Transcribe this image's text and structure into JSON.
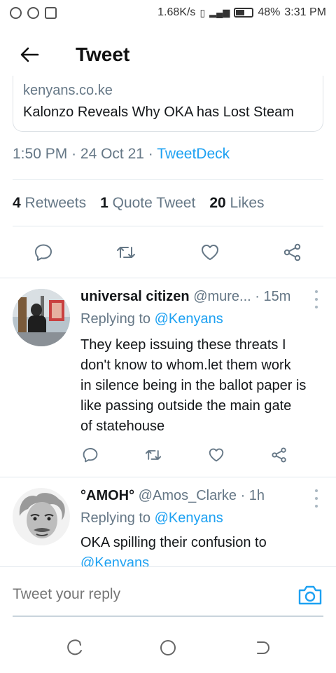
{
  "status_bar": {
    "network_speed": "1.68K/s",
    "battery": "48%",
    "time": "3:31 PM"
  },
  "header": {
    "title": "Tweet"
  },
  "link_card": {
    "domain": "kenyans.co.ke",
    "title": "Kalonzo Reveals Why OKA has Lost Steam"
  },
  "tweet_meta": {
    "time": "1:50 PM",
    "date": "24 Oct 21",
    "source": "TweetDeck"
  },
  "stats": {
    "retweets_count": "4",
    "retweets_label": "Retweets",
    "quotes_count": "1",
    "quotes_label": "Quote Tweet",
    "likes_count": "20",
    "likes_label": "Likes"
  },
  "replies": [
    {
      "name": "universal citizen",
      "handle": "@mure...",
      "time": "15m",
      "replying_prefix": "Replying to",
      "replying_to": "@Kenyans",
      "lines": [
        "They keep issuing these threats I",
        "don't know to whom.let them work",
        "in silence being in the ballot paper is",
        "like passing outside the main gate",
        "of statehouse"
      ]
    },
    {
      "name": "°AMOH°",
      "handle": "@Amos_Clarke",
      "time": "1h",
      "replying_prefix": "Replying to",
      "replying_to": "@Kenyans",
      "lines": [
        "OKA spilling their confusion to"
      ],
      "mention_line": "@Kenyans"
    }
  ],
  "compose": {
    "placeholder": "Tweet your reply"
  },
  "colors": {
    "accent": "#1da1f2",
    "secondary_text": "#657786",
    "primary_text": "#14171a",
    "divider": "#e1e8ed"
  }
}
